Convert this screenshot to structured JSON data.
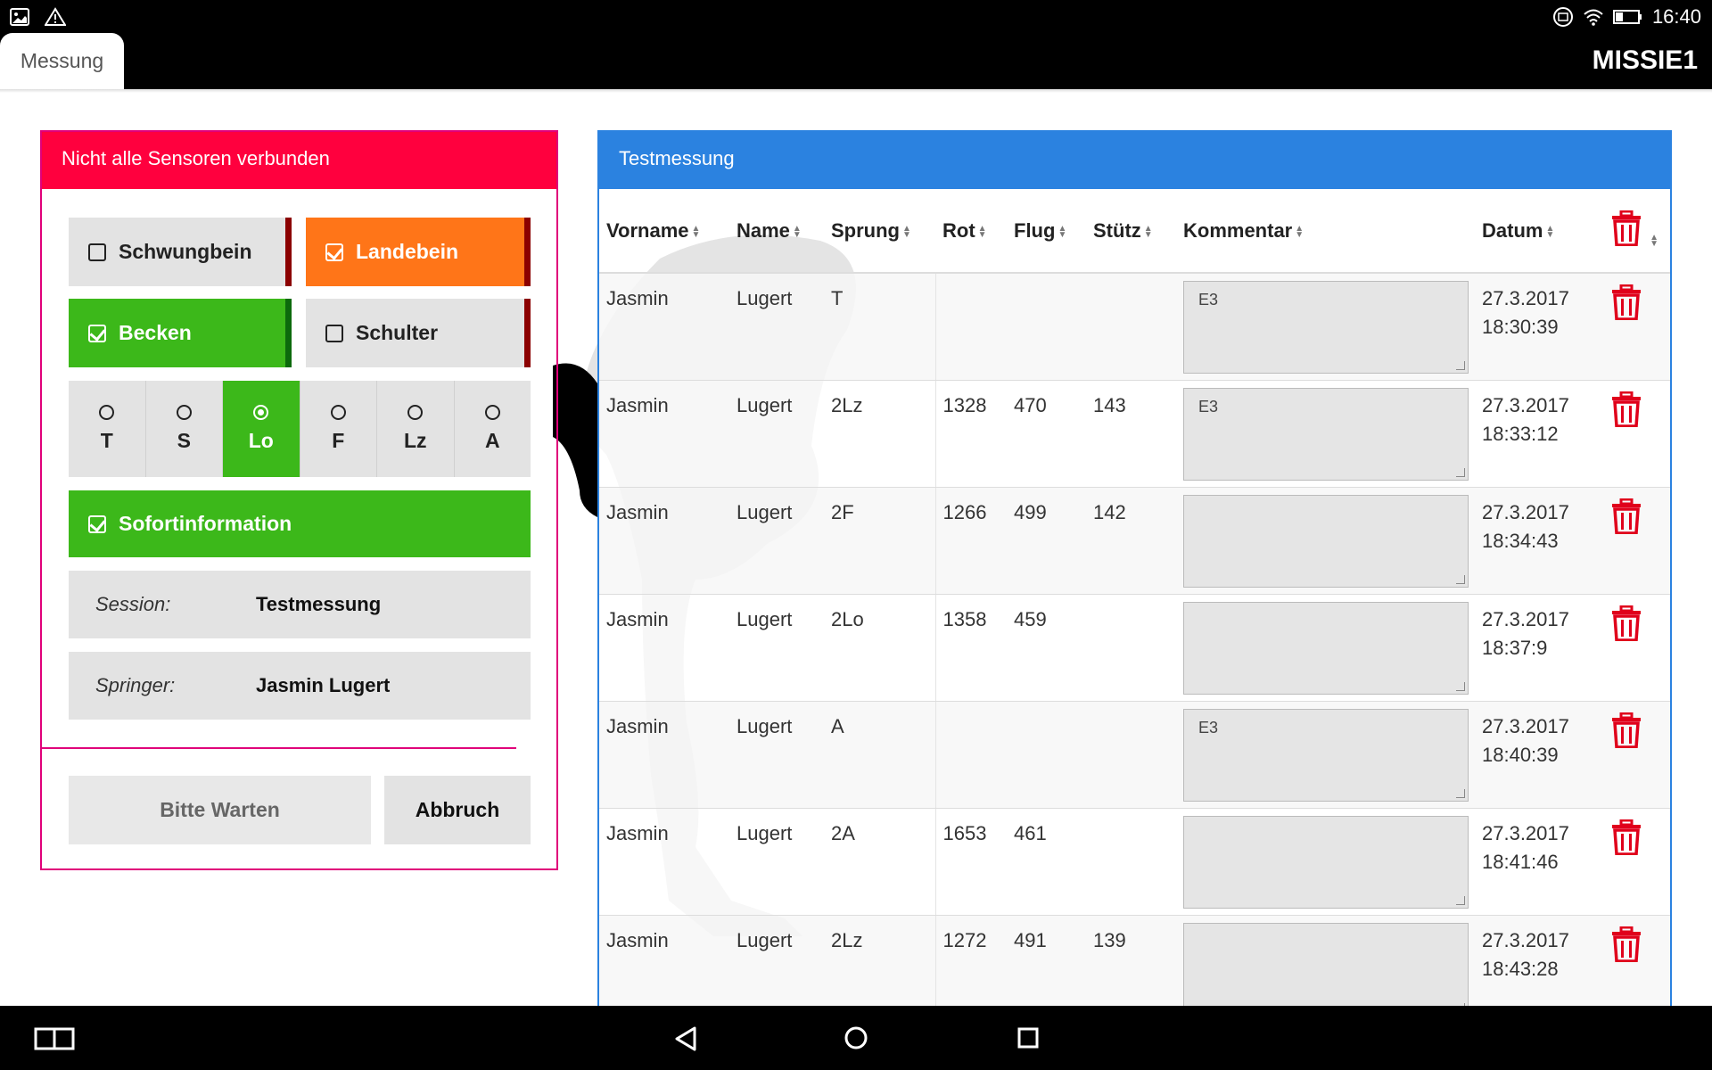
{
  "status_bar": {
    "time": "16:40",
    "left_icons": [
      "image-icon",
      "warning-icon"
    ],
    "right_icons": [
      "cast-icon",
      "wifi-icon",
      "battery-icon"
    ]
  },
  "app": {
    "tab_label": "Messung",
    "title": "MISSIE1"
  },
  "left_panel": {
    "header": "Nicht alle Sensoren verbunden",
    "toggles": [
      {
        "label": "Schwungbein",
        "checked": false
      },
      {
        "label": "Landebein",
        "checked": true
      },
      {
        "label": "Becken",
        "checked": true
      },
      {
        "label": "Schulter",
        "checked": false
      }
    ],
    "jumps": [
      "T",
      "S",
      "Lo",
      "F",
      "Lz",
      "A"
    ],
    "selected_jump": "Lo",
    "sofortinformation": "Sofortinformation",
    "session_label": "Session:",
    "session_value": "Testmessung",
    "springer_label": "Springer:",
    "springer_value": "Jasmin Lugert",
    "wait_button": "Bitte Warten",
    "cancel_button": "Abbruch"
  },
  "right_panel": {
    "header": "Testmessung",
    "columns": [
      "Vorname",
      "Name",
      "Sprung",
      "Rot",
      "Flug",
      "Stütz",
      "Kommentar",
      "Datum"
    ],
    "rows": [
      {
        "vorname": "Jasmin",
        "name": "Lugert",
        "sprung": "T",
        "rot": "",
        "flug": "",
        "stuetz": "",
        "kommentar": "E3",
        "datum": "27.3.2017",
        "zeit": "18:30:39"
      },
      {
        "vorname": "Jasmin",
        "name": "Lugert",
        "sprung": "2Lz",
        "rot": "1328",
        "flug": "470",
        "stuetz": "143",
        "kommentar": "E3",
        "datum": "27.3.2017",
        "zeit": "18:33:12"
      },
      {
        "vorname": "Jasmin",
        "name": "Lugert",
        "sprung": "2F",
        "rot": "1266",
        "flug": "499",
        "stuetz": "142",
        "kommentar": "",
        "datum": "27.3.2017",
        "zeit": "18:34:43"
      },
      {
        "vorname": "Jasmin",
        "name": "Lugert",
        "sprung": "2Lo",
        "rot": "1358",
        "flug": "459",
        "stuetz": "",
        "kommentar": "",
        "datum": "27.3.2017",
        "zeit": "18:37:9"
      },
      {
        "vorname": "Jasmin",
        "name": "Lugert",
        "sprung": "A",
        "rot": "",
        "flug": "",
        "stuetz": "",
        "kommentar": "E3",
        "datum": "27.3.2017",
        "zeit": "18:40:39"
      },
      {
        "vorname": "Jasmin",
        "name": "Lugert",
        "sprung": "2A",
        "rot": "1653",
        "flug": "461",
        "stuetz": "",
        "kommentar": "",
        "datum": "27.3.2017",
        "zeit": "18:41:46"
      },
      {
        "vorname": "Jasmin",
        "name": "Lugert",
        "sprung": "2Lz",
        "rot": "1272",
        "flug": "491",
        "stuetz": "139",
        "kommentar": "",
        "datum": "27.3.2017",
        "zeit": "18:43:28"
      }
    ]
  },
  "nav_bar": {
    "icons": [
      "multiwindow-icon",
      "back-icon",
      "home-icon",
      "recents-icon"
    ]
  },
  "colors": {
    "alert_red": "#ff003e",
    "brand_blue": "#2b82e0",
    "active_green": "#3cb81a",
    "active_orange": "#ff7518",
    "trash_red": "#e0001b"
  }
}
